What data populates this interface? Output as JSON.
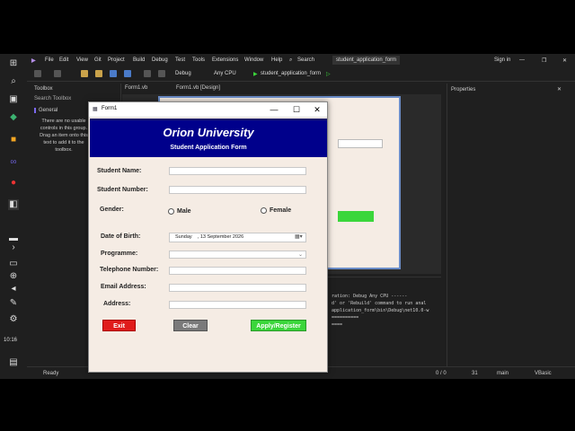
{
  "vs": {
    "menu": [
      "File",
      "Edit",
      "View",
      "Git",
      "Project",
      "Build",
      "Debug",
      "Test",
      "Tools",
      "Extensions",
      "Window",
      "Help"
    ],
    "search": "Search",
    "solution_name": "student_application_form",
    "sign_in": "Sign in",
    "config": "Debug",
    "platform": "Any CPU",
    "start_target": "student_application_form",
    "toolbox_title": "Toolbox",
    "toolbox_search": "Search Toolbox",
    "toolbox_group": "General",
    "toolbox_empty": "There are no usable controls in this group. Drag an item onto this text to add it to the toolbox.",
    "tab_form_vb": "Form1.vb",
    "tab_form_design": "Form1.vb [Design]",
    "properties_title": "Properties",
    "output_lines": [
      "ration: Debug Any CPU ------",
      "d' or 'Rebuild' command to run anal",
      "application_form\\bin\\Debug\\net10.0-w",
      "==========",
      "===="
    ],
    "status_ready": "Ready",
    "status_git": "0 / 0",
    "status_lines": "31",
    "status_branch": "main",
    "status_lang": "VBasic",
    "taskbar_time": "10:16"
  },
  "form": {
    "window_title": "Form1",
    "university": "Orion University",
    "subtitle": "Student Application Form",
    "labels": {
      "student_name": "Student Name:",
      "student_number": "Student Number:",
      "gender": "Gender:",
      "male": "Male",
      "female": "Female",
      "dob": "Date of Birth:",
      "programme": "Programme:",
      "phone": "Telephone Number:",
      "email": "Email Address:",
      "address": "Address:"
    },
    "dob_value": "Sunday    , 13 September 2026",
    "buttons": {
      "exit": "Exit",
      "clear": "Clear",
      "apply": "Apply/Register"
    },
    "colors": {
      "header": "#00008b",
      "exit": "#e01b1b",
      "clear": "#7a7a7a",
      "apply": "#3bd63b"
    }
  }
}
